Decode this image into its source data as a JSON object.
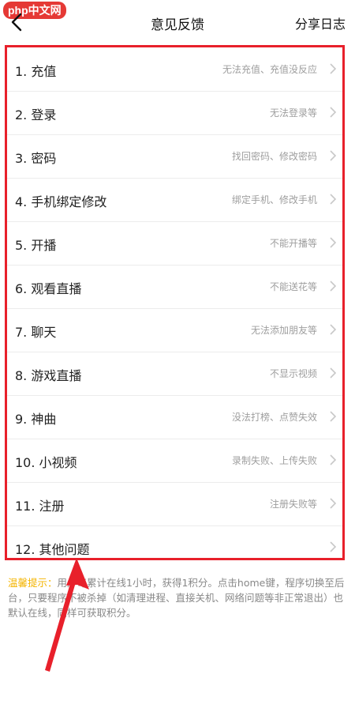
{
  "watermark": "php中文网",
  "header": {
    "title": "意见反馈",
    "share_label": "分享日志"
  },
  "items": [
    {
      "label": "1. 充值",
      "hint": "无法充值、充值没反应"
    },
    {
      "label": "2. 登录",
      "hint": "无法登录等"
    },
    {
      "label": "3. 密码",
      "hint": "找回密码、修改密码"
    },
    {
      "label": "4. 手机绑定修改",
      "hint": "绑定手机、修改手机"
    },
    {
      "label": "5. 开播",
      "hint": "不能开播等"
    },
    {
      "label": "6. 观看直播",
      "hint": "不能送花等"
    },
    {
      "label": "7. 聊天",
      "hint": "无法添加朋友等"
    },
    {
      "label": "8. 游戏直播",
      "hint": "不显示视频"
    },
    {
      "label": "9. 神曲",
      "hint": "没法打榜、点赞失效"
    },
    {
      "label": "10. 小视频",
      "hint": "录制失败、上传失败"
    },
    {
      "label": "11. 注册",
      "hint": "注册失败等"
    },
    {
      "label": "12. 其他问题",
      "hint": ""
    }
  ],
  "tip": {
    "label": "温馨提示：",
    "text": "用户每累计在线1小时，获得1积分。点击home键，程序切换至后台，只要程序不被杀掉（如清理进程、直接关机、网络问题等非正常退出）也默认在线，同样可获取积分。"
  },
  "colors": {
    "highlight": "#e8202b",
    "tip_label": "#f4b400"
  }
}
